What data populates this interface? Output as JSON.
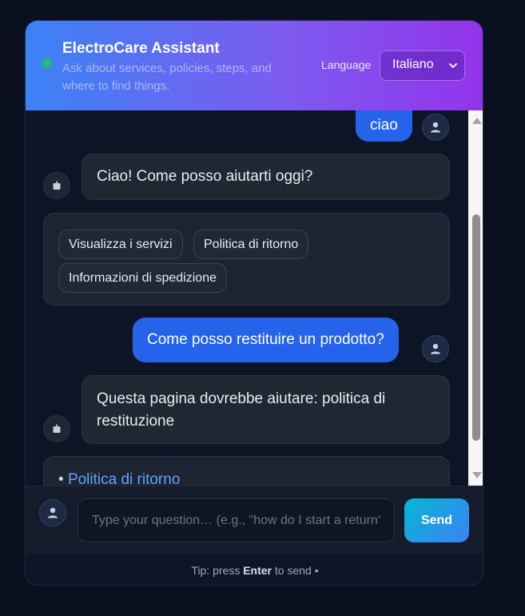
{
  "header": {
    "title": "ElectroCare Assistant",
    "subtitle": "Ask about services, policies, steps, and where to find things.",
    "language_label": "Language",
    "language_selected": "Italiano",
    "status_color": "#22c55e"
  },
  "messages": {
    "user_1": "ciao",
    "bot_1": "Ciao! Come posso aiutarti oggi?",
    "quick_replies": [
      "Visualizza i servizi",
      "Politica di ritorno",
      "Informazioni di spedizione"
    ],
    "user_2": "Come posso restituire un prodotto?",
    "bot_2": "Questa pagina dovrebbe aiutare: politica di restituzione",
    "link_bullet": "•",
    "link_text": "Politica di ritorno"
  },
  "composer": {
    "placeholder": "Type your question… (e.g., \"how do I start a return?\")",
    "send_label": "Send"
  },
  "footer": {
    "tip_prefix": "Tip: press",
    "tip_key": "Enter",
    "tip_suffix": "to send •"
  },
  "icons": {
    "user_avatar": "person-icon",
    "bot_avatar": "bot-icon",
    "language_chevron": "chevron-down-icon"
  },
  "colors": {
    "accent_start": "#3b82f6",
    "accent_end": "#9333ea",
    "user_bubble": "#2563eb",
    "link": "#60a5fa"
  }
}
